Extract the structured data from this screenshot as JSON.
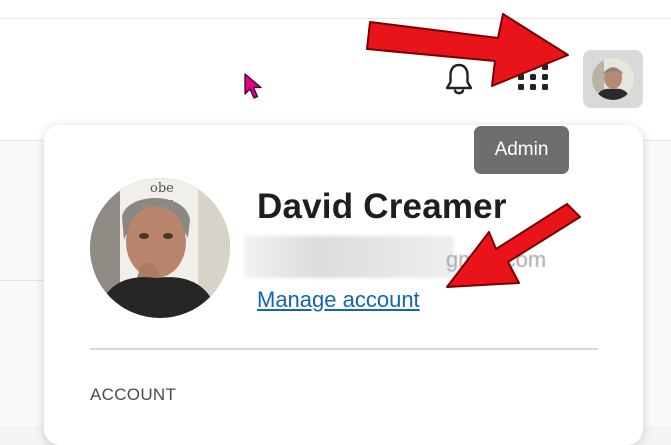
{
  "header": {
    "icons": {
      "notifications": "bell-icon",
      "apps": "apps-grid-icon",
      "avatar": "user-avatar"
    }
  },
  "tooltip": {
    "label": "Admin"
  },
  "profile": {
    "name": "David Creamer",
    "email_visible_tail": "gmail.com",
    "manage_link": "Manage account",
    "section_heading": "ACCOUNT"
  },
  "colors": {
    "link": "#1464b4",
    "annotation_arrow": "#e8141a",
    "tooltip_bg": "#6e6e6e",
    "cursor": "#e0008a"
  }
}
